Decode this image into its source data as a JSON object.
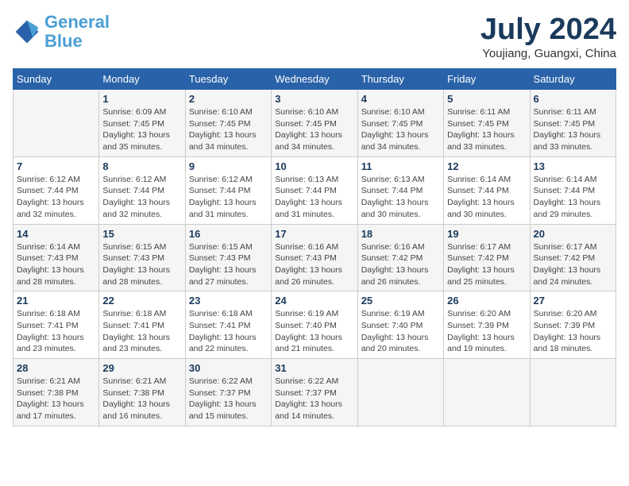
{
  "logo": {
    "line1": "General",
    "line2": "Blue"
  },
  "title": "July 2024",
  "location": "Youjiang, Guangxi, China",
  "weekdays": [
    "Sunday",
    "Monday",
    "Tuesday",
    "Wednesday",
    "Thursday",
    "Friday",
    "Saturday"
  ],
  "weeks": [
    [
      {
        "day": "",
        "info": ""
      },
      {
        "day": "1",
        "info": "Sunrise: 6:09 AM\nSunset: 7:45 PM\nDaylight: 13 hours\nand 35 minutes."
      },
      {
        "day": "2",
        "info": "Sunrise: 6:10 AM\nSunset: 7:45 PM\nDaylight: 13 hours\nand 34 minutes."
      },
      {
        "day": "3",
        "info": "Sunrise: 6:10 AM\nSunset: 7:45 PM\nDaylight: 13 hours\nand 34 minutes."
      },
      {
        "day": "4",
        "info": "Sunrise: 6:10 AM\nSunset: 7:45 PM\nDaylight: 13 hours\nand 34 minutes."
      },
      {
        "day": "5",
        "info": "Sunrise: 6:11 AM\nSunset: 7:45 PM\nDaylight: 13 hours\nand 33 minutes."
      },
      {
        "day": "6",
        "info": "Sunrise: 6:11 AM\nSunset: 7:45 PM\nDaylight: 13 hours\nand 33 minutes."
      }
    ],
    [
      {
        "day": "7",
        "info": "Sunrise: 6:12 AM\nSunset: 7:44 PM\nDaylight: 13 hours\nand 32 minutes."
      },
      {
        "day": "8",
        "info": "Sunrise: 6:12 AM\nSunset: 7:44 PM\nDaylight: 13 hours\nand 32 minutes."
      },
      {
        "day": "9",
        "info": "Sunrise: 6:12 AM\nSunset: 7:44 PM\nDaylight: 13 hours\nand 31 minutes."
      },
      {
        "day": "10",
        "info": "Sunrise: 6:13 AM\nSunset: 7:44 PM\nDaylight: 13 hours\nand 31 minutes."
      },
      {
        "day": "11",
        "info": "Sunrise: 6:13 AM\nSunset: 7:44 PM\nDaylight: 13 hours\nand 30 minutes."
      },
      {
        "day": "12",
        "info": "Sunrise: 6:14 AM\nSunset: 7:44 PM\nDaylight: 13 hours\nand 30 minutes."
      },
      {
        "day": "13",
        "info": "Sunrise: 6:14 AM\nSunset: 7:44 PM\nDaylight: 13 hours\nand 29 minutes."
      }
    ],
    [
      {
        "day": "14",
        "info": "Sunrise: 6:14 AM\nSunset: 7:43 PM\nDaylight: 13 hours\nand 28 minutes."
      },
      {
        "day": "15",
        "info": "Sunrise: 6:15 AM\nSunset: 7:43 PM\nDaylight: 13 hours\nand 28 minutes."
      },
      {
        "day": "16",
        "info": "Sunrise: 6:15 AM\nSunset: 7:43 PM\nDaylight: 13 hours\nand 27 minutes."
      },
      {
        "day": "17",
        "info": "Sunrise: 6:16 AM\nSunset: 7:43 PM\nDaylight: 13 hours\nand 26 minutes."
      },
      {
        "day": "18",
        "info": "Sunrise: 6:16 AM\nSunset: 7:42 PM\nDaylight: 13 hours\nand 26 minutes."
      },
      {
        "day": "19",
        "info": "Sunrise: 6:17 AM\nSunset: 7:42 PM\nDaylight: 13 hours\nand 25 minutes."
      },
      {
        "day": "20",
        "info": "Sunrise: 6:17 AM\nSunset: 7:42 PM\nDaylight: 13 hours\nand 24 minutes."
      }
    ],
    [
      {
        "day": "21",
        "info": "Sunrise: 6:18 AM\nSunset: 7:41 PM\nDaylight: 13 hours\nand 23 minutes."
      },
      {
        "day": "22",
        "info": "Sunrise: 6:18 AM\nSunset: 7:41 PM\nDaylight: 13 hours\nand 23 minutes."
      },
      {
        "day": "23",
        "info": "Sunrise: 6:18 AM\nSunset: 7:41 PM\nDaylight: 13 hours\nand 22 minutes."
      },
      {
        "day": "24",
        "info": "Sunrise: 6:19 AM\nSunset: 7:40 PM\nDaylight: 13 hours\nand 21 minutes."
      },
      {
        "day": "25",
        "info": "Sunrise: 6:19 AM\nSunset: 7:40 PM\nDaylight: 13 hours\nand 20 minutes."
      },
      {
        "day": "26",
        "info": "Sunrise: 6:20 AM\nSunset: 7:39 PM\nDaylight: 13 hours\nand 19 minutes."
      },
      {
        "day": "27",
        "info": "Sunrise: 6:20 AM\nSunset: 7:39 PM\nDaylight: 13 hours\nand 18 minutes."
      }
    ],
    [
      {
        "day": "28",
        "info": "Sunrise: 6:21 AM\nSunset: 7:38 PM\nDaylight: 13 hours\nand 17 minutes."
      },
      {
        "day": "29",
        "info": "Sunrise: 6:21 AM\nSunset: 7:38 PM\nDaylight: 13 hours\nand 16 minutes."
      },
      {
        "day": "30",
        "info": "Sunrise: 6:22 AM\nSunset: 7:37 PM\nDaylight: 13 hours\nand 15 minutes."
      },
      {
        "day": "31",
        "info": "Sunrise: 6:22 AM\nSunset: 7:37 PM\nDaylight: 13 hours\nand 14 minutes."
      },
      {
        "day": "",
        "info": ""
      },
      {
        "day": "",
        "info": ""
      },
      {
        "day": "",
        "info": ""
      }
    ]
  ]
}
